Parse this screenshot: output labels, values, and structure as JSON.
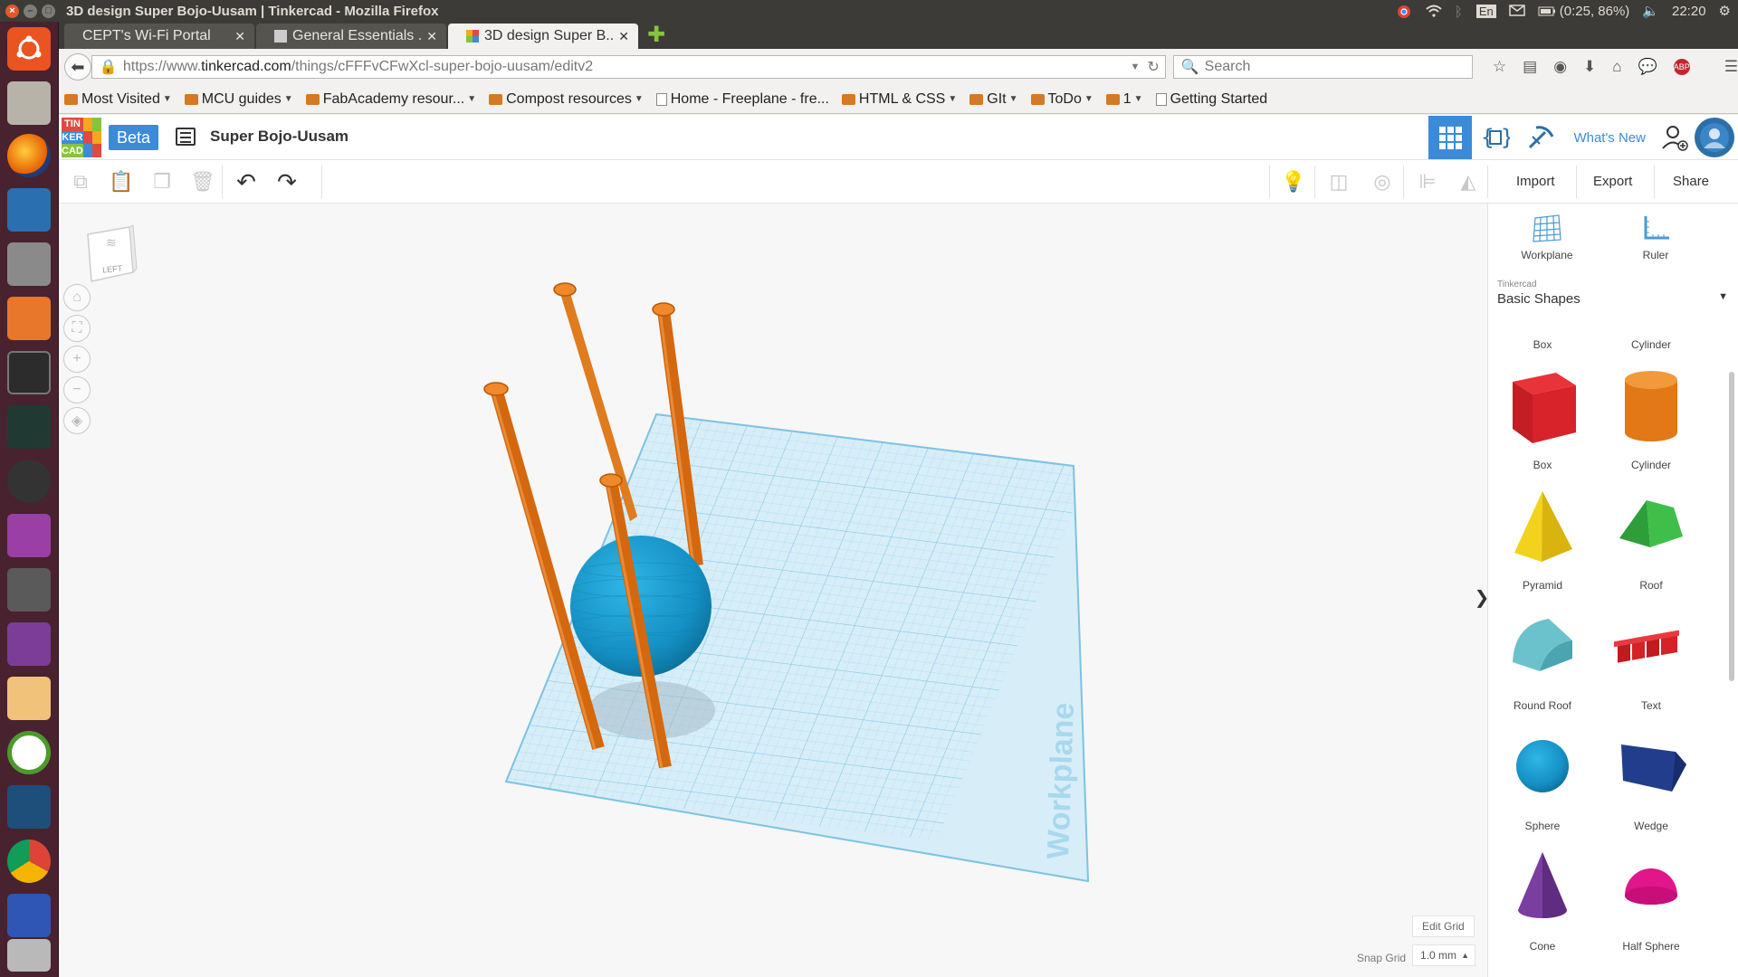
{
  "window": {
    "title": "3D design Super Bojo-Uusam | Tinkercad - Mozilla Firefox",
    "tray": {
      "keyboard": "En",
      "battery": "(0:25, 86%)",
      "clock": "22:20"
    }
  },
  "browser": {
    "tabs": [
      {
        "label": "CEPT's Wi-Fi Portal"
      },
      {
        "label": "General Essentials ..."
      },
      {
        "label": "3D design Super B..."
      }
    ],
    "url": {
      "prefix": "https://www.",
      "host": "tinkercad.com",
      "path": "/things/cFFFvCFwXcl-super-bojo-uusam/editv2"
    },
    "search_placeholder": "Search",
    "bookmarks": [
      {
        "label": "Most Visited",
        "type": "folder",
        "dropdown": true
      },
      {
        "label": "MCU guides",
        "type": "folder",
        "dropdown": true
      },
      {
        "label": "FabAcademy resour...",
        "type": "folder",
        "dropdown": true
      },
      {
        "label": "Compost resources",
        "type": "folder",
        "dropdown": true
      },
      {
        "label": "Home - Freeplane - fre...",
        "type": "page",
        "dropdown": false
      },
      {
        "label": "HTML & CSS",
        "type": "folder",
        "dropdown": true
      },
      {
        "label": "GIt",
        "type": "folder",
        "dropdown": true
      },
      {
        "label": "ToDo",
        "type": "folder",
        "dropdown": true
      },
      {
        "label": "1",
        "type": "folder",
        "dropdown": true
      },
      {
        "label": "Getting Started",
        "type": "page",
        "dropdown": false
      }
    ]
  },
  "app": {
    "logo_letters": [
      "TIN",
      "KER",
      "CAD"
    ],
    "badge": "Beta",
    "design_name": "Super Bojo-Uusam",
    "whats_new": "What's New",
    "actions": {
      "import": "Import",
      "export": "Export",
      "share": "Share"
    },
    "viewcube_label": "LEFT",
    "workplane_label": "Workplane",
    "edit_grid": "Edit Grid",
    "snap_grid_label": "Snap Grid",
    "snap_grid_value": "1.0 mm",
    "accent_color": "#3c8bd9"
  },
  "panel": {
    "tools": [
      {
        "label": "Workplane"
      },
      {
        "label": "Ruler"
      }
    ],
    "library_provider": "Tinkercad",
    "library": "Basic Shapes",
    "shapes": [
      {
        "label": "Box",
        "icon": "box-hole-icon"
      },
      {
        "label": "Cylinder",
        "icon": "cylinder-hole-icon"
      },
      {
        "label": "Box",
        "icon": "box-icon"
      },
      {
        "label": "Cylinder",
        "icon": "cylinder-icon"
      },
      {
        "label": "Pyramid",
        "icon": "pyramid-icon"
      },
      {
        "label": "Roof",
        "icon": "roof-icon"
      },
      {
        "label": "Round Roof",
        "icon": "round-roof-icon"
      },
      {
        "label": "Text",
        "icon": "text-shape-icon"
      },
      {
        "label": "Sphere",
        "icon": "sphere-icon"
      },
      {
        "label": "Wedge",
        "icon": "wedge-icon"
      },
      {
        "label": "Cone",
        "icon": "cone-icon"
      },
      {
        "label": "Half Sphere",
        "icon": "half-sphere-icon"
      }
    ]
  }
}
